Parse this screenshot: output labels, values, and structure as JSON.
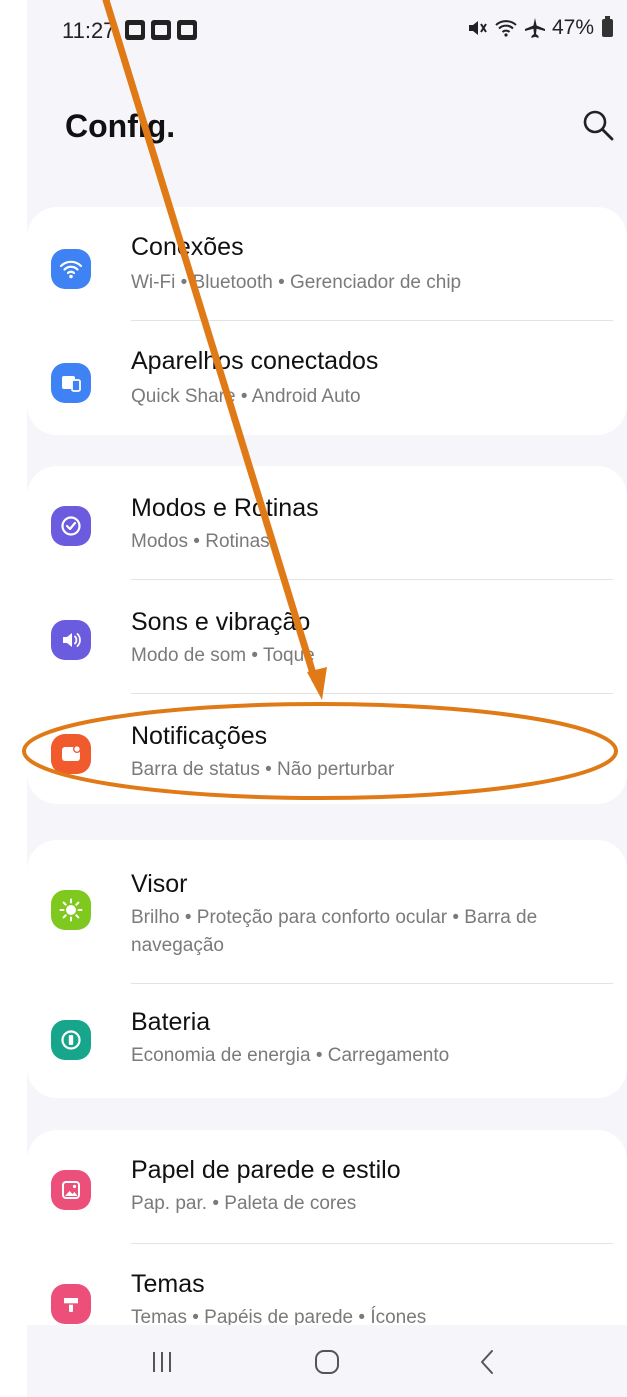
{
  "status_bar": {
    "time": "11:27",
    "battery": "47%",
    "icons": [
      "gallery-notification-icon",
      "sim-notification-icon",
      "sim-notification-icon",
      "mute-icon",
      "wifi-icon",
      "airplane-icon",
      "battery-icon"
    ]
  },
  "header": {
    "title": "Config.",
    "search_icon": "search-icon"
  },
  "groups": [
    {
      "items": [
        {
          "label": "Conexões",
          "subtitle": "Wi-Fi • Bluetooth • Gerenciador de chip",
          "icon": "wifi-icon",
          "color": "#3f82f3"
        },
        {
          "label": "Aparelhos conectados",
          "subtitle": "Quick Share • Android Auto",
          "icon": "connected-devices-icon",
          "color": "#3f82f3"
        }
      ]
    },
    {
      "items": [
        {
          "label": "Modos e Rotinas",
          "subtitle": "Modos • Rotinas",
          "icon": "modes-routines-icon",
          "color": "#6b5bdf"
        },
        {
          "label": "Sons e vibração",
          "subtitle": "Modo de som • Toque",
          "icon": "volume-icon",
          "color": "#6b5bdf"
        },
        {
          "label": "Notificações",
          "subtitle": "Barra de status • Não perturbar",
          "icon": "notification-icon",
          "color": "#f05a2c"
        }
      ]
    },
    {
      "items": [
        {
          "label": "Visor",
          "subtitle": "Brilho • Proteção para conforto ocular • Barra de navegação",
          "icon": "brightness-icon",
          "color": "#7fc81e"
        },
        {
          "label": "Bateria",
          "subtitle": "Economia de energia • Carregamento",
          "icon": "battery-care-icon",
          "color": "#17a58b"
        }
      ]
    },
    {
      "items": [
        {
          "label": "Papel de parede e estilo",
          "subtitle": "Pap. par. • Paleta de cores",
          "icon": "wallpaper-icon",
          "color": "#ec4f7a"
        },
        {
          "label": "Temas",
          "subtitle": "Temas • Papéis de parede • Ícones",
          "icon": "themes-icon",
          "color": "#ec4f7a"
        }
      ]
    }
  ],
  "nav_bar": {
    "buttons": [
      "recent-apps-icon",
      "home-icon",
      "back-icon"
    ]
  },
  "annotation": {
    "color": "#e07a17",
    "highlighted_item": "Notificações"
  }
}
